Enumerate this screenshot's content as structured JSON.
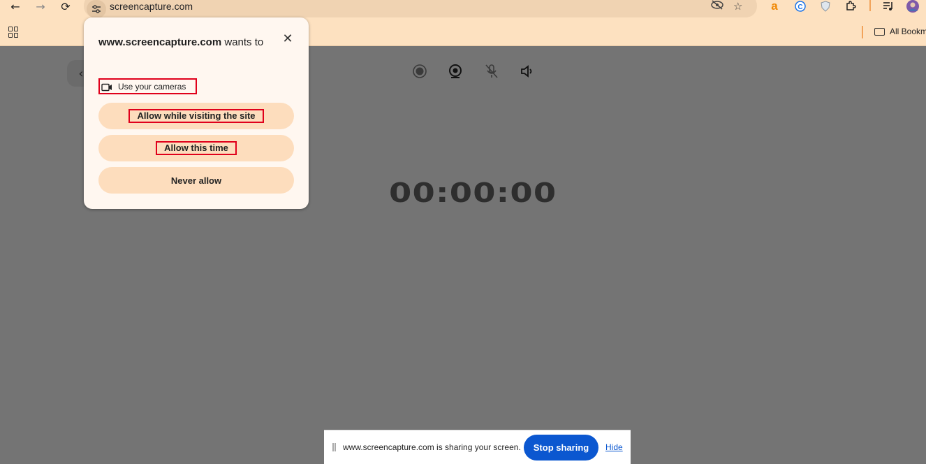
{
  "browser": {
    "url": "screencapture.com",
    "bookmarks_label": "All Bookmarks",
    "extensions": [
      "amazon-icon",
      "c-icon",
      "shield-icon",
      "puzzle-icon",
      "media-icon",
      "profile-avatar"
    ]
  },
  "permission_popup": {
    "site": "www.screencapture.com",
    "wants_to": "wants to",
    "permission_text": "Use your cameras",
    "buttons": {
      "allow_while_visiting": "Allow while visiting the site",
      "allow_this_time": "Allow this time",
      "never_allow": "Never allow"
    }
  },
  "page": {
    "timer": "00:00:00",
    "controls": [
      "record-icon",
      "webcam-icon",
      "mic-off-icon",
      "speaker-icon"
    ]
  },
  "share_bar": {
    "message": "www.screencapture.com is sharing your screen.",
    "stop_label": "Stop sharing",
    "hide_label": "Hide"
  },
  "colors": {
    "chrome": "#fde1c0",
    "popup_button": "#fdddbd",
    "stop_button": "#0b57d0",
    "overlay": "#747474",
    "highlight": "#e0001b"
  }
}
